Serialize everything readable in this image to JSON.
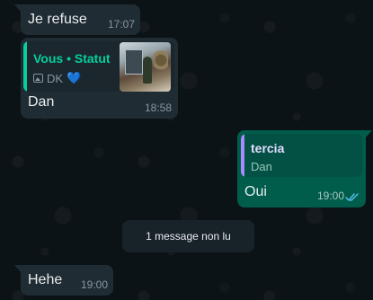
{
  "messages": [
    {
      "direction": "incoming",
      "text": "Je refuse",
      "time": "17:07"
    },
    {
      "direction": "incoming",
      "quote": {
        "title": "Vous • Statut",
        "subtitle": "DK",
        "emoji": "💙",
        "media_icon": "photo-icon",
        "accent_color": "#06cf9c"
      },
      "text": "Dan",
      "time": "18:58"
    },
    {
      "direction": "outgoing",
      "quote": {
        "title": "tercia",
        "subtitle": "Dan",
        "accent_color": "#a78bfa"
      },
      "text": "Oui",
      "time": "19:00",
      "status_icon": "double-check-read-icon"
    },
    {
      "direction": "incoming",
      "text": "Hehe",
      "time": "19:00"
    }
  ],
  "unread_divider": "1 message non lu",
  "colors": {
    "incoming_bubble": "#202c33",
    "outgoing_bubble": "#005c4b",
    "read_ticks": "#53bdeb"
  }
}
